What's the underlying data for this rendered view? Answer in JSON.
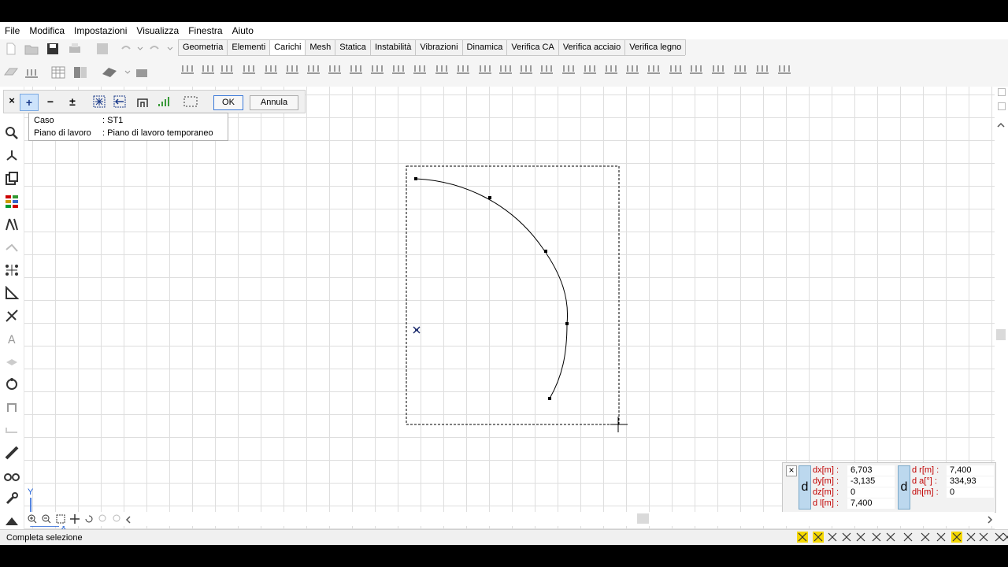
{
  "menu": [
    "File",
    "Modifica",
    "Impostazioni",
    "Visualizza",
    "Finestra",
    "Aiuto"
  ],
  "tabs": [
    {
      "label": "Geometria",
      "active": false
    },
    {
      "label": "Elementi",
      "active": false
    },
    {
      "label": "Carichi",
      "active": true
    },
    {
      "label": "Mesh",
      "active": false
    },
    {
      "label": "Statica",
      "active": false
    },
    {
      "label": "Instabilità",
      "active": false
    },
    {
      "label": "Vibrazioni",
      "active": false
    },
    {
      "label": "Dinamica",
      "active": false
    },
    {
      "label": "Verifica CA",
      "active": false
    },
    {
      "label": "Verifica acciaio",
      "active": false
    },
    {
      "label": "Verifica legno",
      "active": false
    }
  ],
  "command": {
    "close": "×",
    "plus": "+",
    "minus": "−",
    "toggle": "±",
    "ok": "OK",
    "cancel": "Annula"
  },
  "info": {
    "case_label": "Caso",
    "case_value": ": ST1",
    "plane_label": "Piano di lavoro",
    "plane_value": ": Piano di lavoro temporaneo"
  },
  "axes": {
    "x": "X",
    "y": "Y"
  },
  "readout": {
    "close": "×",
    "d": "d",
    "dx_label": "dx[m] :",
    "dx_value": "6,703",
    "dy_label": "dy[m] :",
    "dy_value": "-3,135",
    "dz_label": "dz[m] :",
    "dz_value": "0",
    "dl_label": "d l[m] :",
    "dl_value": "7,400",
    "dr_label": "d r[m] :",
    "dr_value": "7,400",
    "da_label": "d a[°] :",
    "da_value": "334,93",
    "dh_label": "dh[m] :",
    "dh_value": "0"
  },
  "status": {
    "text": "Completa selezione"
  },
  "colors": {
    "accent": "#3b79d8",
    "readout_label": "#c00000",
    "grid": "#dedede",
    "active_icon": "#f5d800"
  }
}
